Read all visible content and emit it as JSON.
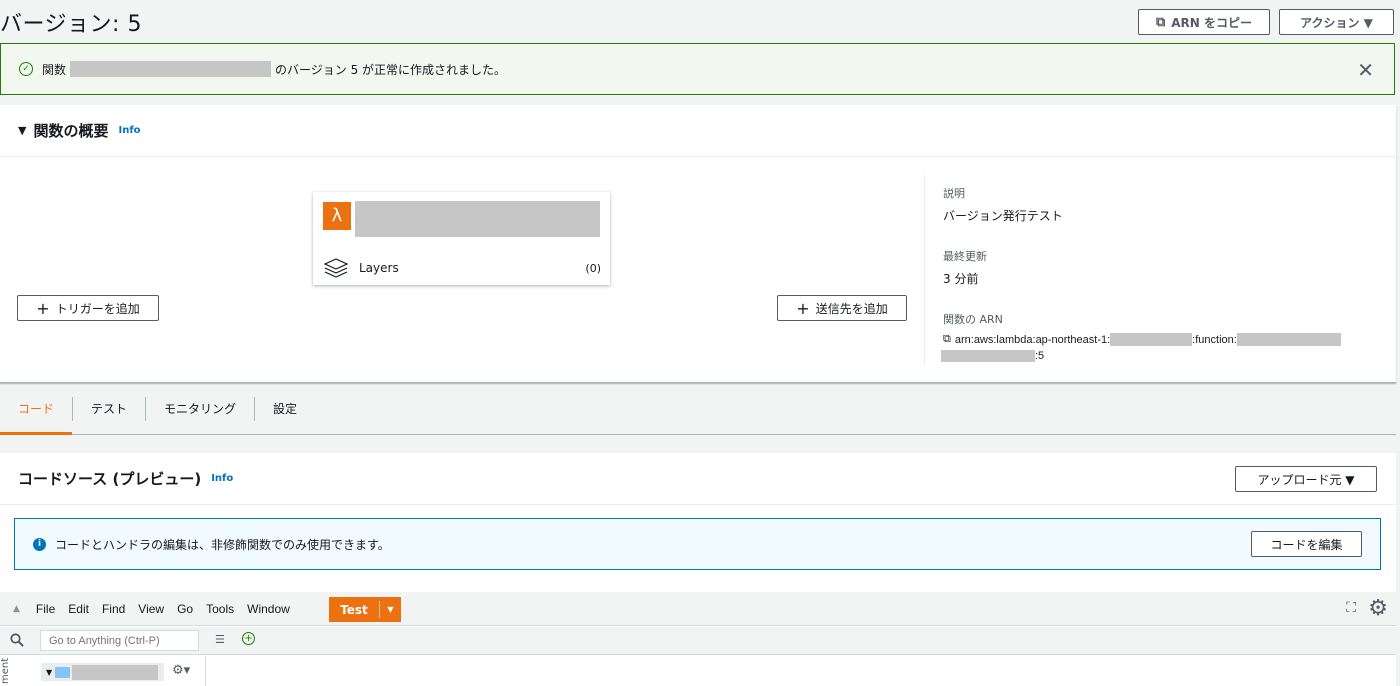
{
  "header": {
    "title": "バージョン: 5",
    "copy_arn_label": "ARN をコピー",
    "actions_label": "アクション ▼"
  },
  "flash": {
    "prefix": "関数",
    "suffix": "のバージョン 5 が正常に作成されました。",
    "close": "✕"
  },
  "overview": {
    "title": "関数の概要",
    "info": "Info",
    "layers_label": "Layers",
    "layers_count": "(0)",
    "add_trigger": "トリガーを追加",
    "add_destination": "送信先を追加",
    "desc_label": "説明",
    "desc_value": "バージョン発行テスト",
    "updated_label": "最終更新",
    "updated_value": "3 分前",
    "arn_label": "関数の ARN",
    "arn_part1": "arn:aws:lambda:ap-northeast-1:",
    "arn_part2": ":function:",
    "arn_part3": ":5"
  },
  "tabs": [
    {
      "label": "コード"
    },
    {
      "label": "テスト"
    },
    {
      "label": "モニタリング"
    },
    {
      "label": "設定"
    }
  ],
  "code_source": {
    "title": "コードソース (プレビュー)",
    "info": "Info",
    "upload_label": "アップロード元 ▼",
    "notice": "コードとハンドラの編集は、非修飾関数でのみ使用できます。",
    "edit_label": "コードを編集"
  },
  "ide": {
    "menu": [
      "File",
      "Edit",
      "Find",
      "View",
      "Go",
      "Tools",
      "Window"
    ],
    "test_label": "Test",
    "goto_placeholder": "Go to Anything (Ctrl-P)",
    "side_label": "ment"
  },
  "colors": {
    "accent": "#ec7211",
    "success": "#1d8102",
    "info": "#0073bb"
  }
}
